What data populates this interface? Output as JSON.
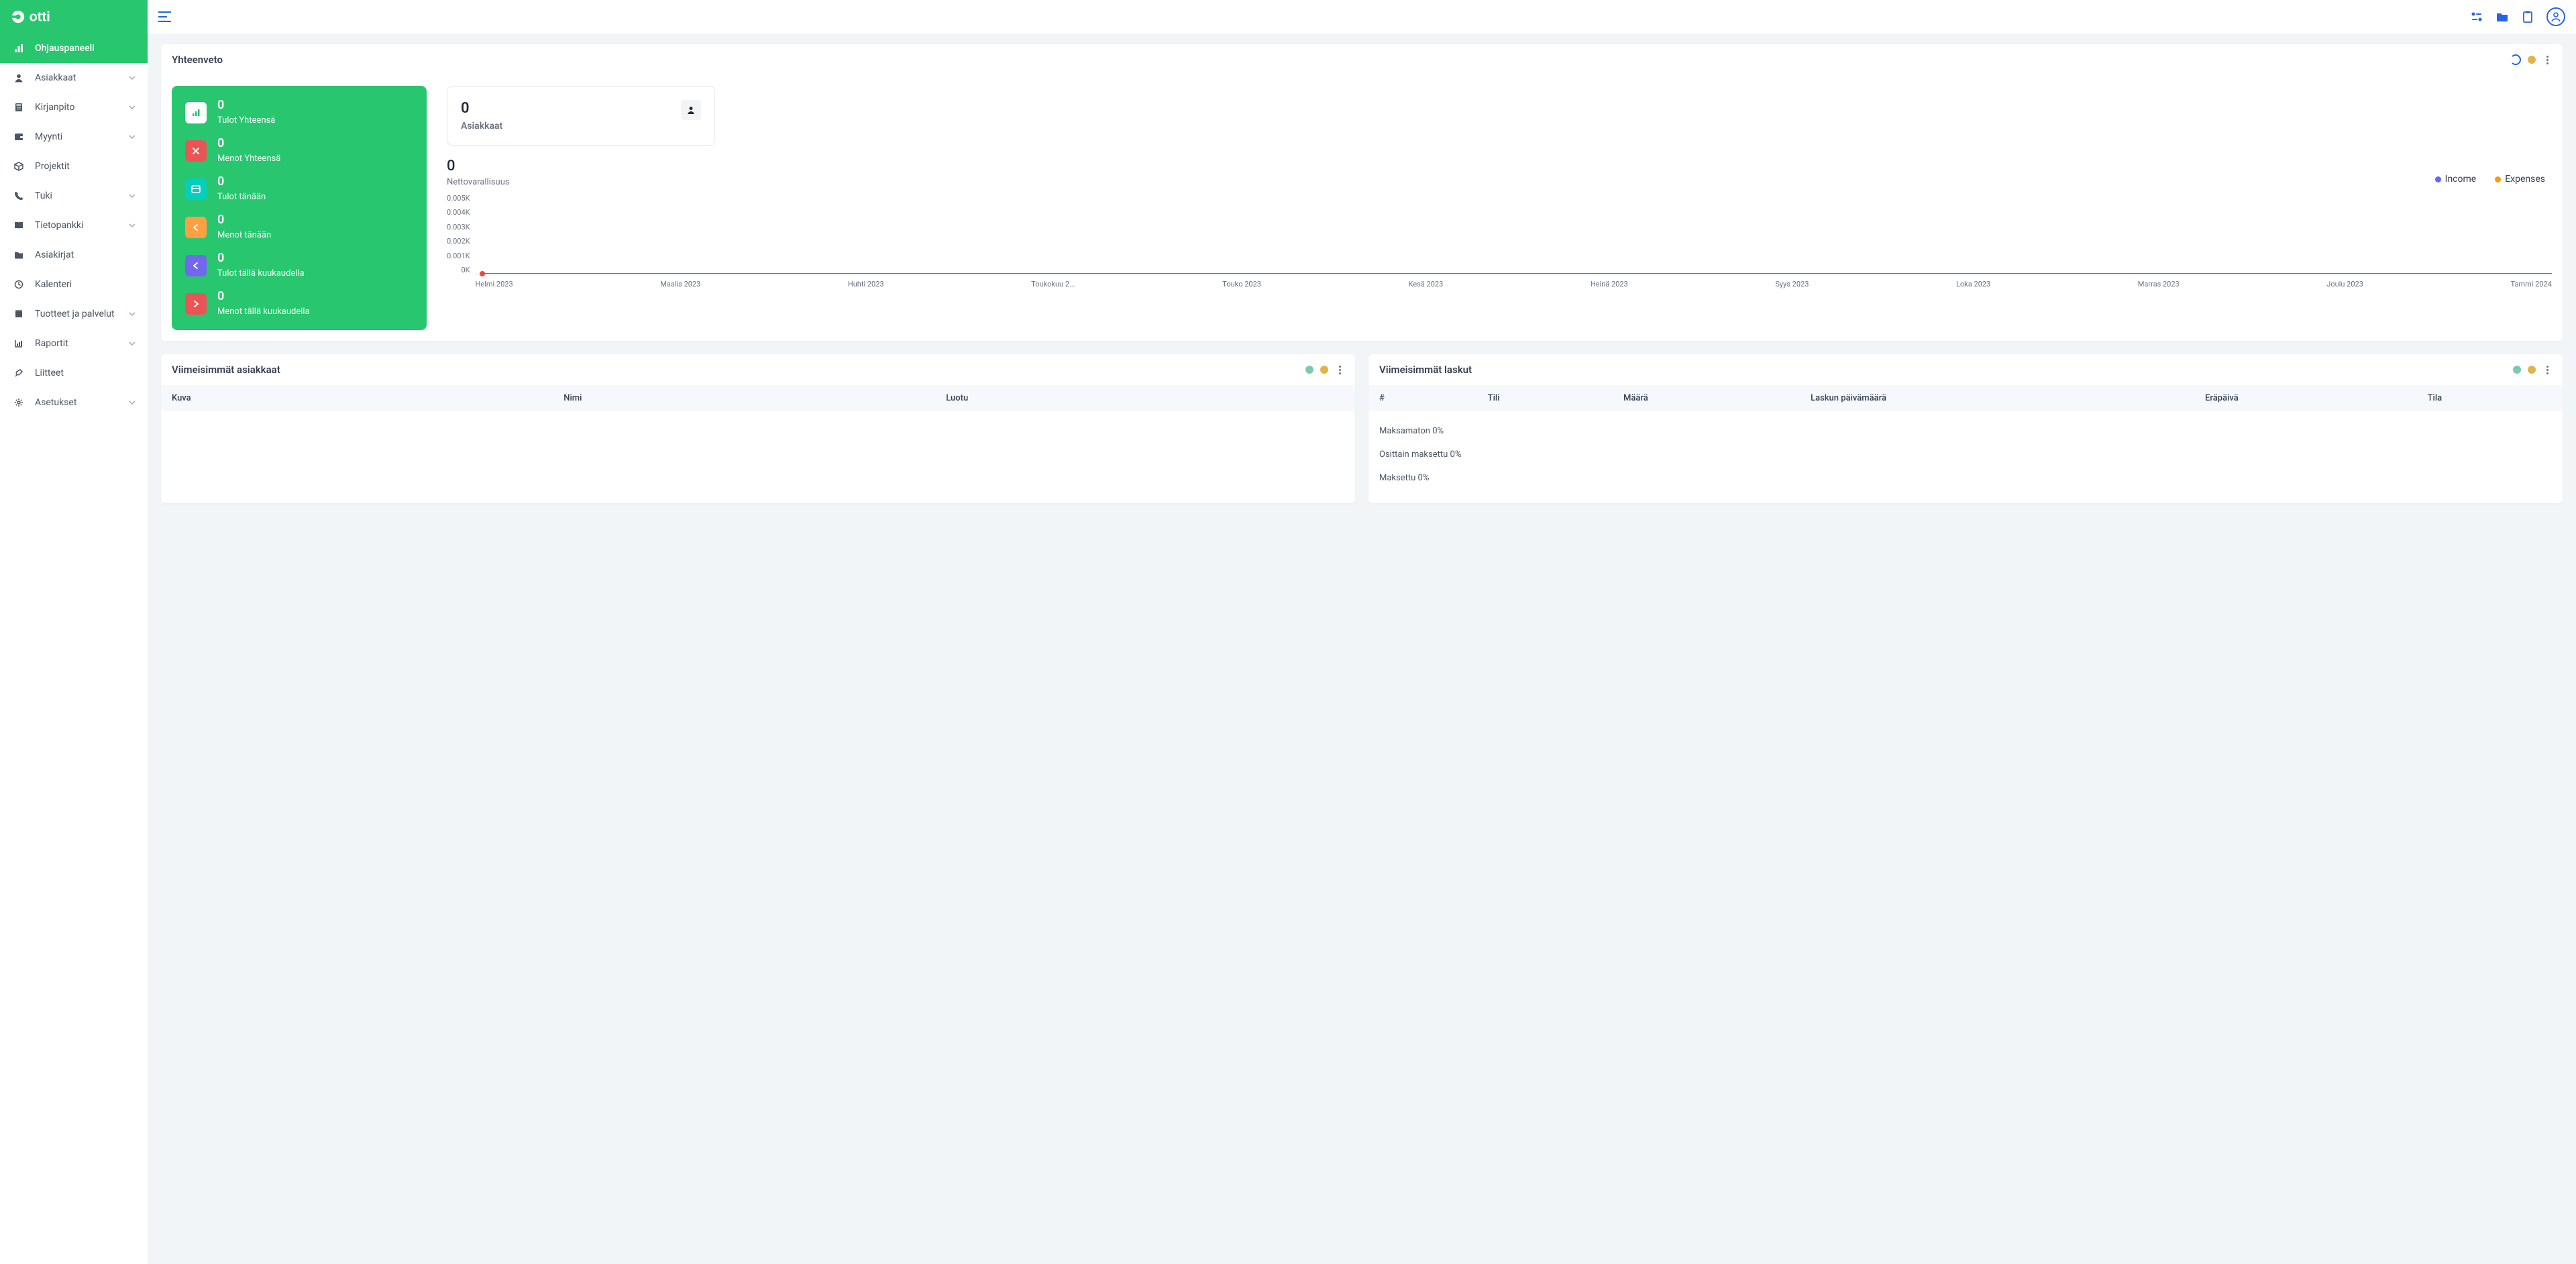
{
  "brand": "Dotti",
  "nav": [
    {
      "label": "Ohjauspaneeli",
      "icon": "bars",
      "active": true,
      "chev": false
    },
    {
      "label": "Asiakkaat",
      "icon": "user",
      "chev": true
    },
    {
      "label": "Kirjanpito",
      "icon": "calc",
      "chev": true
    },
    {
      "label": "Myynti",
      "icon": "wallet",
      "chev": true
    },
    {
      "label": "Projektit",
      "icon": "box",
      "chev": false
    },
    {
      "label": "Tuki",
      "icon": "phone",
      "chev": true
    },
    {
      "label": "Tietopankki",
      "icon": "book",
      "chev": true
    },
    {
      "label": "Asiakirjat",
      "icon": "folder",
      "chev": false
    },
    {
      "label": "Kalenteri",
      "icon": "clock",
      "chev": false
    },
    {
      "label": "Tuotteet ja palvelut",
      "icon": "product",
      "chev": true
    },
    {
      "label": "Raportit",
      "icon": "chart",
      "chev": true
    },
    {
      "label": "Liitteet",
      "icon": "pin",
      "chev": false
    },
    {
      "label": "Asetukset",
      "icon": "gear",
      "chev": true
    }
  ],
  "overview": {
    "title": "Yhteenveto",
    "stats": [
      {
        "val": "0",
        "lbl": "Tulot Yhteensä",
        "cls": "si-white",
        "glyph": "bars"
      },
      {
        "val": "0",
        "lbl": "Menot Yhteensä",
        "cls": "si-red",
        "glyph": "x"
      },
      {
        "val": "0",
        "lbl": "Tulot tänään",
        "cls": "si-teal",
        "glyph": "card"
      },
      {
        "val": "0",
        "lbl": "Menot tänään",
        "cls": "si-yellow",
        "glyph": "left"
      },
      {
        "val": "0",
        "lbl": "Tulot tällä kuukaudella",
        "cls": "si-purple",
        "glyph": "left2"
      },
      {
        "val": "0",
        "lbl": "Menot tällä kuukaudella",
        "cls": "si-pink",
        "glyph": "right"
      }
    ],
    "clients": {
      "val": "0",
      "lbl": "Asiakkaat"
    },
    "networth": {
      "val": "0",
      "lbl": "Nettovarallisuus"
    },
    "legend": {
      "income": "Income",
      "expenses": "Expenses"
    }
  },
  "chart_data": {
    "type": "line",
    "categories": [
      "Helmi 2023",
      "Maalis 2023",
      "Huhti 2023",
      "Toukokuu 2...",
      "Touko 2023",
      "Kesä 2023",
      "Heinä 2023",
      "Syys 2023",
      "Loka 2023",
      "Marras 2023",
      "Joulu 2023",
      "Tammi 2024"
    ],
    "series": [
      {
        "name": "Income",
        "values": [
          0,
          0,
          0,
          0,
          0,
          0,
          0,
          0,
          0,
          0,
          0,
          0
        ]
      },
      {
        "name": "Expenses",
        "values": [
          0,
          0,
          0,
          0,
          0,
          0,
          0,
          0,
          0,
          0,
          0,
          0
        ]
      }
    ],
    "yticks": [
      "0.005K",
      "0.004K",
      "0.003K",
      "0.002K",
      "0.001K",
      "0K"
    ],
    "ylim": [
      0,
      0.005
    ],
    "title": "",
    "xlabel": "",
    "ylabel": ""
  },
  "recent_clients": {
    "title": "Viimeisimmät asiakkaat",
    "cols": [
      "Kuva",
      "Nimi",
      "Luotu"
    ]
  },
  "recent_invoices": {
    "title": "Viimeisimmät laskut",
    "cols": [
      "#",
      "Tili",
      "Määrä",
      "Laskun päivämäärä",
      "Eräpäivä",
      "Tila"
    ],
    "statuses": [
      "Maksamaton 0%",
      "Osittain maksettu 0%",
      "Maksettu 0%"
    ]
  }
}
